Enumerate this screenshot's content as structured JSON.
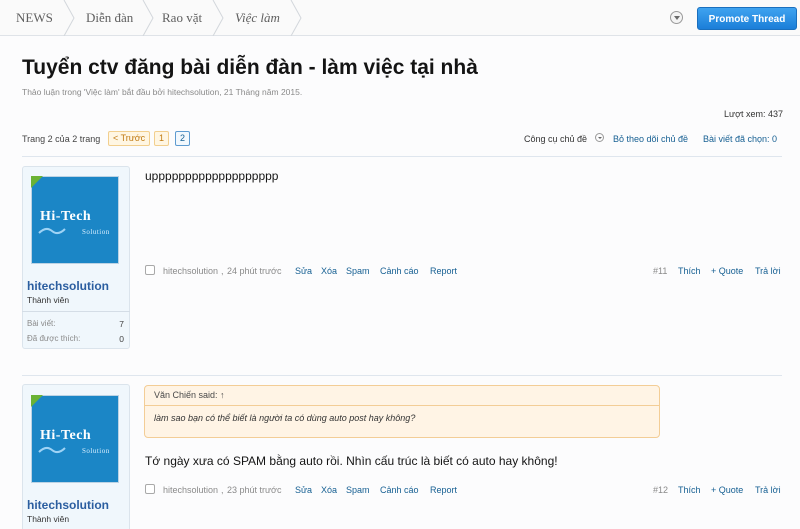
{
  "breadcrumb": {
    "items": [
      "NEWS",
      "Diễn đàn",
      "Rao vặt",
      "Việc làm"
    ]
  },
  "header": {
    "promote_label": "Promote Thread"
  },
  "thread": {
    "title": "Tuyển ctv đăng bài diễn đàn - làm việc tại nhà",
    "description": "Thảo luận trong 'Việc làm' bắt đầu bởi hitechsolution, 21 Tháng năm 2015.",
    "views": "Lượt xem: 437"
  },
  "pagination": {
    "label": "Trang 2 của 2 trang",
    "prev": "< Trước",
    "pages": [
      "1",
      "2"
    ],
    "current": "2"
  },
  "thread_tools": {
    "label": "Công cụ chủ đề",
    "unwatch": "Bỏ theo dõi chủ đề",
    "selected": "Bài viết đã chọn: 0"
  },
  "posts": [
    {
      "username": "hitechsolution",
      "user_title": "Thành viên",
      "stats": [
        {
          "label": "Bài viết:",
          "value": "7"
        },
        {
          "label": "Đã được thích:",
          "value": "0"
        }
      ],
      "avatar_text": "Hi-Tech",
      "avatar_subtext": "Solution",
      "message": "uppppppppppppppppppp",
      "author": "hitechsolution",
      "time": "24 phút trước",
      "actions": [
        "Sửa",
        "Xóa",
        "Spam",
        "Cảnh cáo",
        "Report"
      ],
      "number": "#11",
      "like": "Thích",
      "quote": "+ Quote",
      "reply": "Trả lời"
    },
    {
      "username": "hitechsolution",
      "user_title": "Thành viên",
      "avatar_text": "Hi-Tech",
      "avatar_subtext": "Solution",
      "quote_author": "Văn Chiến said: ↑",
      "quote_text": "làm sao bạn có thể biết là người ta có dùng auto post hay không?",
      "message": "Tớ ngày xưa có SPAM bằng auto rồi. Nhìn cấu trúc là biết có auto hay không!",
      "author": "hitechsolution",
      "time": "23 phút trước",
      "actions": [
        "Sửa",
        "Xóa",
        "Spam",
        "Cảnh cáo",
        "Report"
      ],
      "number": "#12",
      "like": "Thích",
      "quote": "+ Quote",
      "reply": "Trả lời"
    }
  ],
  "colors": {
    "link": "#176093",
    "username": "#2b5ea0",
    "promote": "#1b7ed8",
    "quote_bg": "#fff4e5",
    "avatar_bg": "#1b86c6"
  }
}
